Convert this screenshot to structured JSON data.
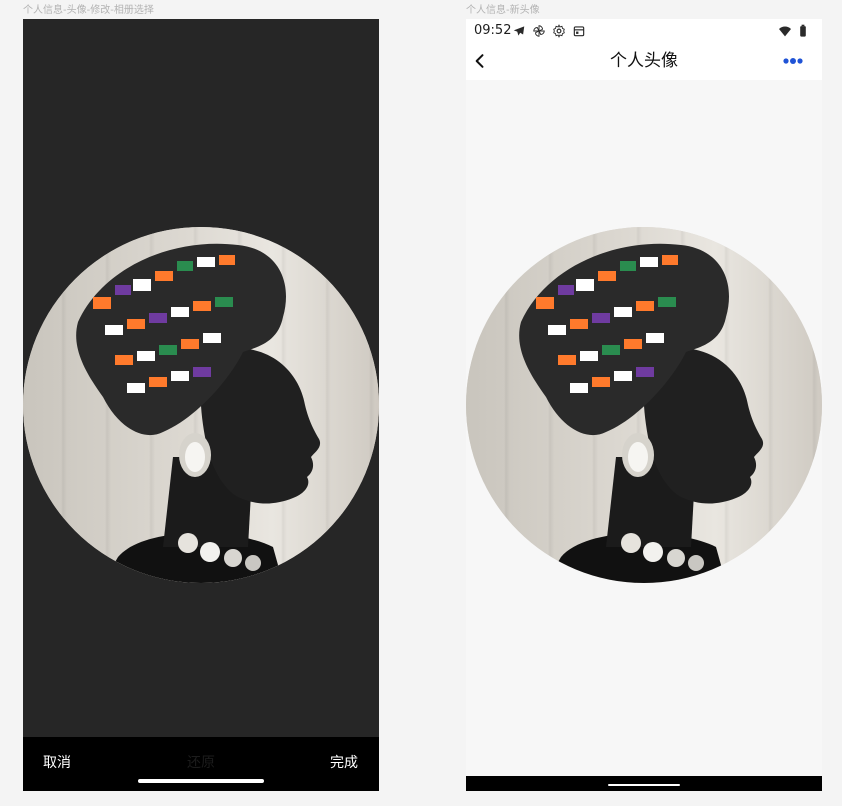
{
  "labels": {
    "left_artboard": "个人信息-头像-修改-相册选择",
    "right_artboard": "个人信息-新头像"
  },
  "crop_screen": {
    "cancel_label": "取消",
    "center_label": "还原",
    "done_label": "完成"
  },
  "avatar_screen": {
    "status_time": "09:52",
    "title": "个人头像",
    "accent_color": "#1f53d6"
  },
  "icons": {
    "back": "chevron-left-icon",
    "more": "more-dots-icon",
    "wifi": "wifi-icon",
    "battery": "battery-icon"
  }
}
